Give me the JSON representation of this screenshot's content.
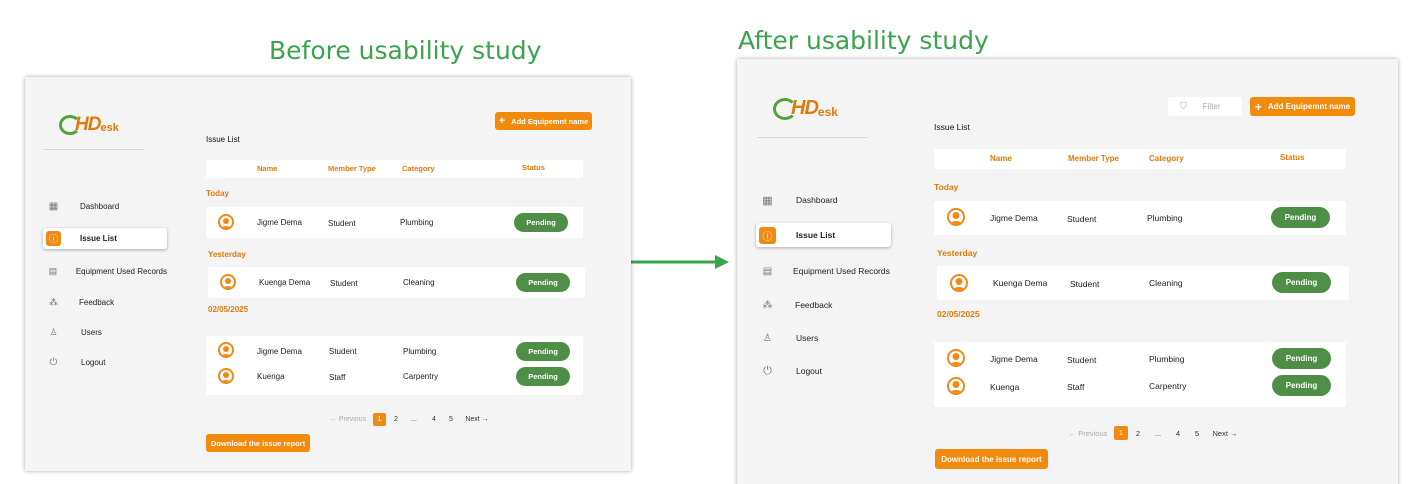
{
  "headings": {
    "before": "Before usability study",
    "after": "After usability study"
  },
  "logo": {
    "hd": "HD",
    "esk": "esk"
  },
  "nav": [
    {
      "label": "Dashboard",
      "icon": "dashboard-icon"
    },
    {
      "label": "Issue List",
      "icon": "info-icon"
    },
    {
      "label": "Equipment Used Records",
      "icon": "records-icon"
    },
    {
      "label": "Feedback",
      "icon": "feedback-icon"
    },
    {
      "label": "Users",
      "icon": "users-icon"
    },
    {
      "label": "Logout",
      "icon": "power-icon"
    }
  ],
  "main": {
    "add_button": "Add Equipemnt name",
    "filter_label": "Filter",
    "page_title": "Issue List",
    "columns": {
      "name": "Name",
      "member_type": "Member Type",
      "category": "Category",
      "status": "Status"
    },
    "groups": {
      "today": "Today",
      "yesterday": "Yesterday",
      "date": "02/05/2025"
    },
    "rows": {
      "today": {
        "name": "Jigme Dema",
        "type": "Student",
        "category": "Plumbing",
        "status": "Pending"
      },
      "yesterday": {
        "name": "Kuenga  Dema",
        "type": "Student",
        "category": "Cleaning",
        "status": "Pending"
      },
      "date1": {
        "name": "Jigme Dema",
        "type": "Student",
        "category": "Plumbing",
        "status": "Pending"
      },
      "date2": {
        "name": "Kuenga",
        "type": "Staff",
        "category": "Carpentry",
        "status": "Pending"
      }
    },
    "pager": {
      "prev": "← Previous",
      "p1": "1",
      "p2": "2",
      "dots": "...",
      "p4": "4",
      "p5": "5",
      "next": "Next →"
    },
    "download_button": "Download the issue report"
  },
  "colors": {
    "accent": "#f28a0d",
    "pending": "#4e8e47",
    "heading": "#3aa34d",
    "logo_green": "#4fa53b"
  }
}
